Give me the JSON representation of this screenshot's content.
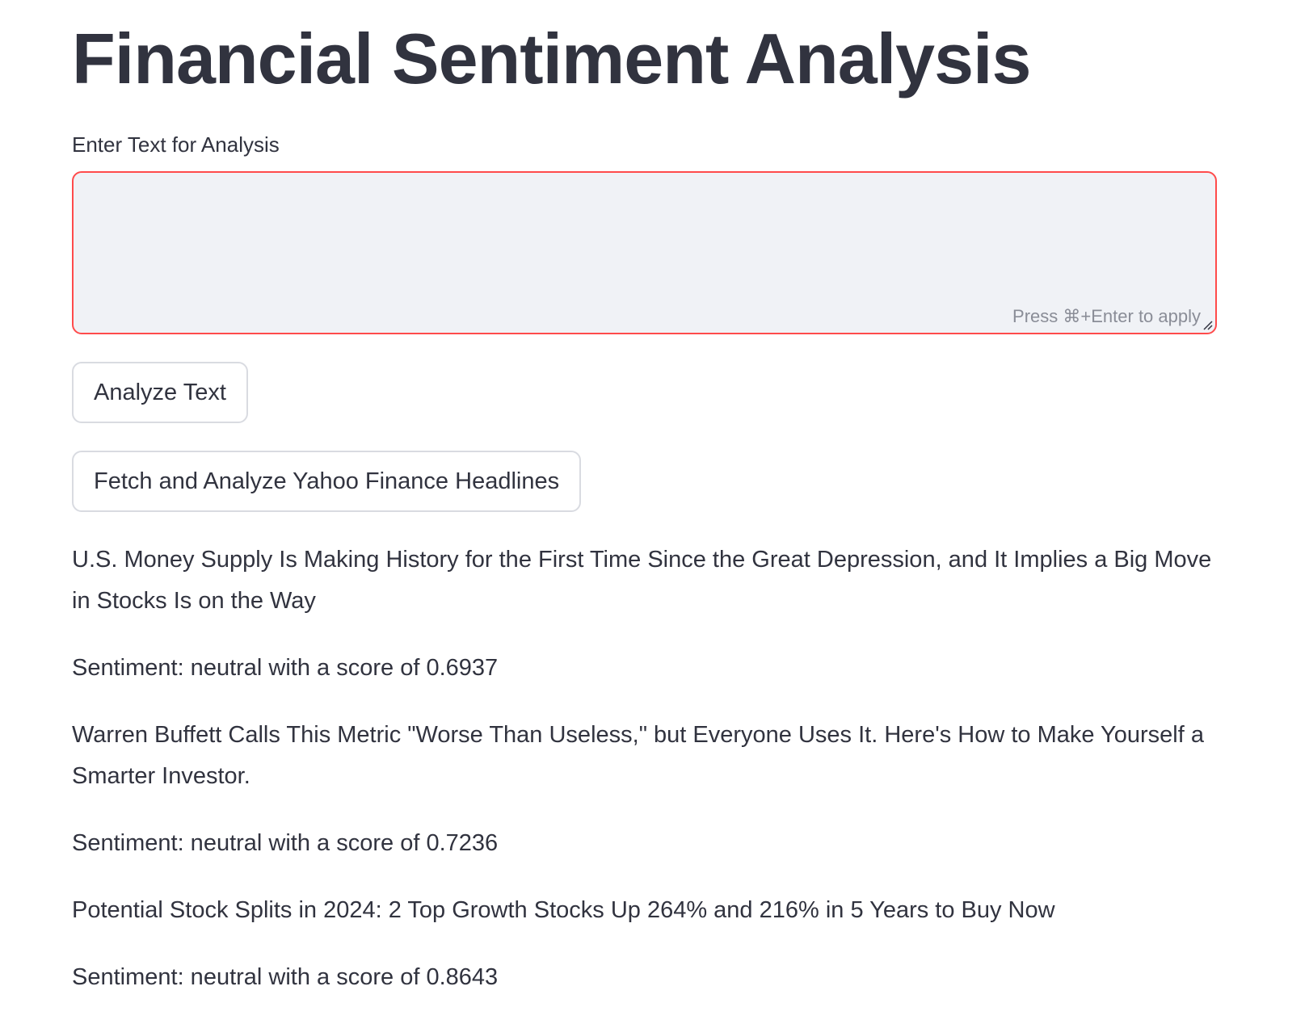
{
  "page": {
    "title": "Financial Sentiment Analysis"
  },
  "input": {
    "label": "Enter Text for Analysis",
    "value": "",
    "placeholder": "",
    "hint": "Press ⌘+Enter to apply"
  },
  "buttons": {
    "analyze_label": "Analyze Text",
    "fetch_label": "Fetch and Analyze Yahoo Finance Headlines"
  },
  "colors": {
    "accent": "#ff4b4b",
    "text": "#31333f",
    "input_bg": "#f0f2f6",
    "button_border": "#d9dbe1"
  },
  "results": [
    {
      "headline": "U.S. Money Supply Is Making History for the First Time Since the Great Depression, and It Implies a Big Move in Stocks Is on the Way",
      "sentiment": "Sentiment: neutral with a score of 0.6937"
    },
    {
      "headline": "Warren Buffett Calls This Metric \"Worse Than Useless,\" but Everyone Uses It. Here's How to Make Yourself a Smarter Investor.",
      "sentiment": "Sentiment: neutral with a score of 0.7236"
    },
    {
      "headline": "Potential Stock Splits in 2024: 2 Top Growth Stocks Up 264% and 216% in 5 Years to Buy Now",
      "sentiment": "Sentiment: neutral with a score of 0.8643"
    }
  ]
}
